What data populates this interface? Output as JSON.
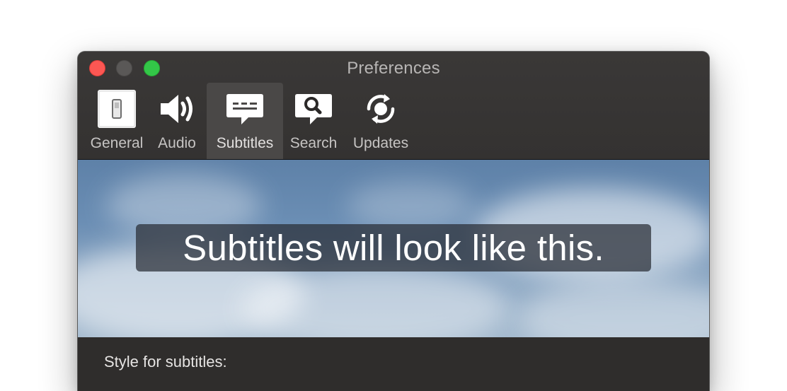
{
  "window": {
    "title": "Preferences"
  },
  "toolbar": {
    "items": [
      {
        "label": "General",
        "icon": "switch-icon",
        "selected": false
      },
      {
        "label": "Audio",
        "icon": "speaker-icon",
        "selected": false
      },
      {
        "label": "Subtitles",
        "icon": "subtitles-icon",
        "selected": true
      },
      {
        "label": "Search",
        "icon": "search-icon",
        "selected": false
      },
      {
        "label": "Updates",
        "icon": "refresh-icon",
        "selected": false
      }
    ]
  },
  "preview": {
    "subtitle_text": "Subtitles will look like this."
  },
  "settings": {
    "style_label": "Style for subtitles:"
  },
  "colors": {
    "window_bg": "#2b2928",
    "toolbar_selected": "#4a4847",
    "close": "#fc5753",
    "minimize": "#5a5857",
    "zoom": "#33c748"
  }
}
